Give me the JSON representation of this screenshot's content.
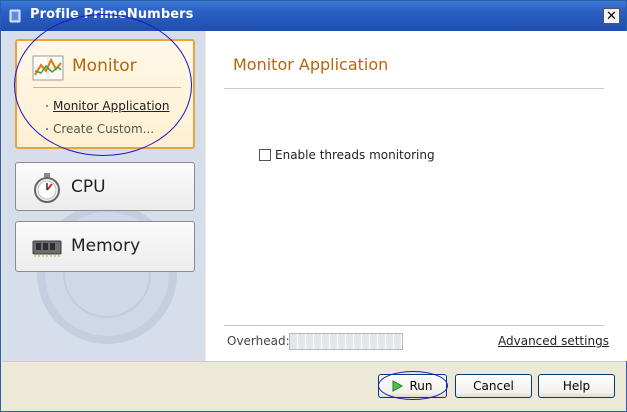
{
  "window": {
    "title": "Profile PrimeNumbers",
    "app_icon": "java-cup-icon",
    "close_label": "✕"
  },
  "sidebar": {
    "categories": [
      {
        "label": "Monitor",
        "icon": "monitor-chart-icon",
        "selected": true,
        "sub_items": [
          "Monitor Application",
          "Create Custom..."
        ]
      },
      {
        "label": "CPU",
        "icon": "stopwatch-icon",
        "selected": false
      },
      {
        "label": "Memory",
        "icon": "memory-chip-icon",
        "selected": false
      }
    ]
  },
  "content": {
    "title": "Monitor Application",
    "checkbox_label": "Enable threads monitoring",
    "checkbox_checked": false,
    "overhead_label": "Overhead:",
    "advanced_label": "Advanced settings"
  },
  "footer": {
    "run_label": "Run",
    "cancel_label": "Cancel",
    "help_label": "Help"
  },
  "colors": {
    "accent": "#b8650e",
    "annotation": "#1c16c8",
    "selected_border": "#e8a43a",
    "titlebar": "#2a5fc4"
  }
}
